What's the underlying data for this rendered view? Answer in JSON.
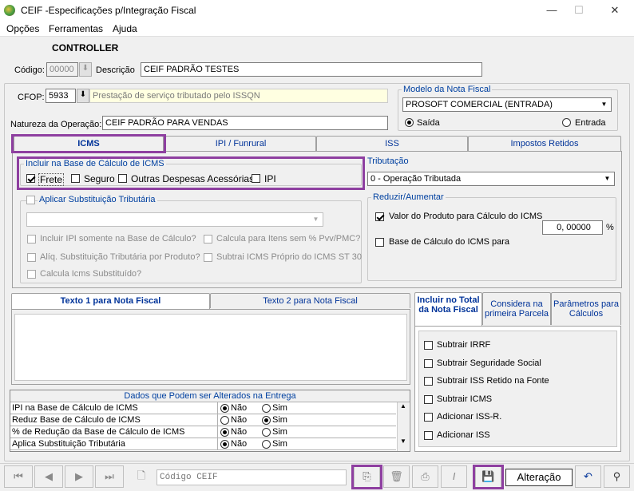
{
  "window": {
    "title": "CEIF -Especificações p/Integração Fiscal",
    "min": "—",
    "max": "☐",
    "close": "✕"
  },
  "menu": {
    "opcoes": "Opções",
    "ferramentas": "Ferramentas",
    "ajuda": "Ajuda"
  },
  "header": {
    "controller": "CONTROLLER",
    "codigo_label": "Código:",
    "codigo_value": "00000",
    "descricao_label": "Descrição",
    "descricao_value": "CEIF PADRÃO TESTES"
  },
  "cfop": {
    "label": "CFOP:",
    "value": "5933",
    "description": "Prestação de serviço tributado pelo ISSQN"
  },
  "natureza": {
    "label": "Natureza da Operação:",
    "value": "CEIF PADRÃO PARA VENDAS"
  },
  "modelo": {
    "legend": "Modelo da Nota Fiscal",
    "value": "PROSOFT COMERCIAL (ENTRADA)",
    "saida": "Saída",
    "entrada": "Entrada"
  },
  "tabs": [
    "ICMS",
    "IPI / Funrural",
    "ISS",
    "Impostos Retidos"
  ],
  "incluir_base": {
    "legend": "Incluir na Base de Cálculo de ICMS",
    "frete": "Frete",
    "seguro": "Seguro",
    "outras": "Outras Despesas Acessórias",
    "ipi": "IPI"
  },
  "tributacao": {
    "legend": "Tributação",
    "value": "0 - Operação Tributada"
  },
  "subst": {
    "legend": "Aplicar Substituição Tributária",
    "opt1": "Incluir IPI somente na Base de Cálculo?",
    "opt2": "Calcula para Itens sem % Pvv/PMC?",
    "opt3": "Alíq. Substituição Tributária por Produto?",
    "opt4": "Subtrai ICMS Próprio do ICMS ST 30",
    "opt5": "Calcula Icms Substituído?"
  },
  "reduzir": {
    "legend": "Reduzir/Aumentar",
    "opt1": "Valor do Produto para Cálculo do ICMS",
    "value": "0, 00000",
    "pct": "%",
    "opt2": "Base de Cálculo do ICMS para"
  },
  "texto_tabs": {
    "t1": "Texto 1 para Nota Fiscal",
    "t2": "Texto 2 para Nota Fiscal"
  },
  "right_tabs": {
    "t1": "Incluir no Total da Nota Fiscal",
    "t2": "Considera na primeira Parcela",
    "t3": "Parâmetros para Cálculos"
  },
  "total_opts": [
    "Subtrair IRRF",
    "Subtrair Seguridade Social",
    "Subtrair ISS Retido na Fonte",
    "Subtrair ICMS",
    "Adicionar ISS-R.",
    "Adicionar ISS"
  ],
  "grid": {
    "title": "Dados que Podem ser Alterados na Entrega",
    "nao": "Não",
    "sim": "Sim",
    "rows": [
      {
        "label": "IPI na Base de Cálculo de ICMS",
        "sel": "nao"
      },
      {
        "label": "Reduz Base de Cálculo de ICMS",
        "sel": "sim"
      },
      {
        "label": "% de Redução da Base de Cálculo de ICMS",
        "sel": "nao"
      },
      {
        "label": "Aplica Substituição Tributária",
        "sel": "nao"
      }
    ]
  },
  "toolbar": {
    "search_placeholder": "Código CEIF",
    "status": "Alteração"
  }
}
